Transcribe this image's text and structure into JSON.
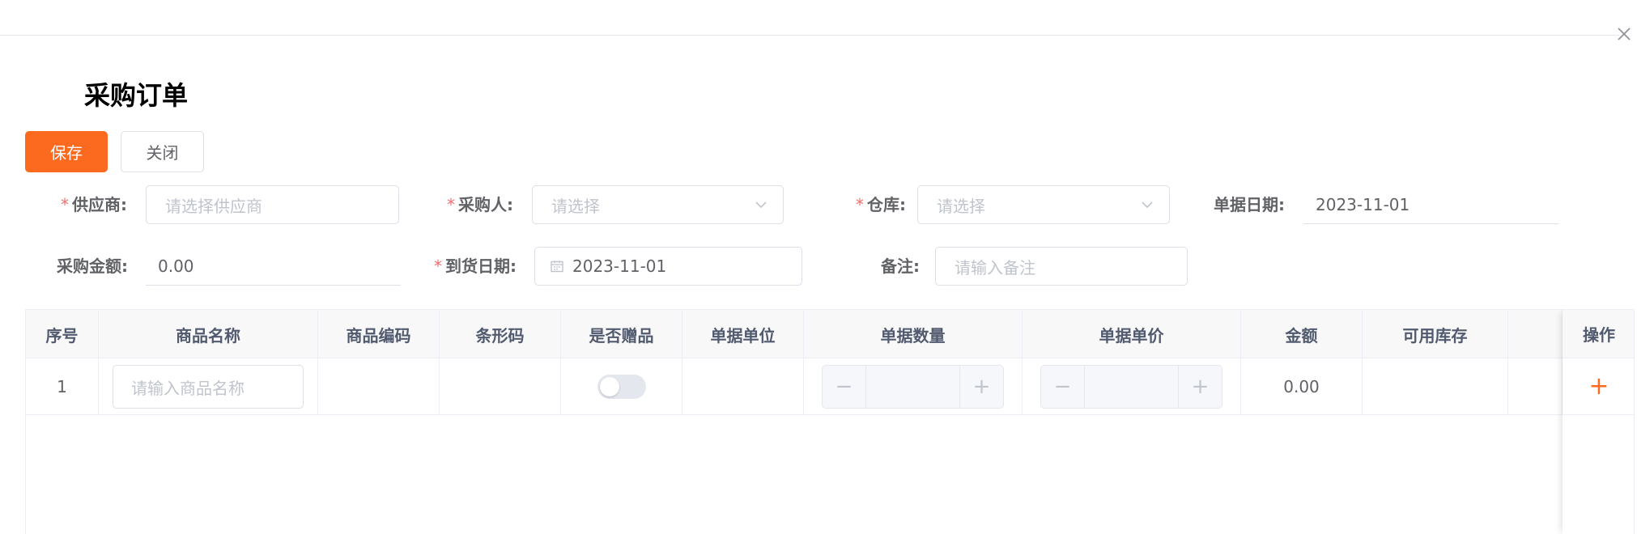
{
  "page": {
    "title": "采购订单"
  },
  "toolbar": {
    "save_label": "保存",
    "close_label": "关闭"
  },
  "form": {
    "supplier": {
      "label": "供应商:",
      "placeholder": "请选择供应商"
    },
    "purchaser": {
      "label": "采购人:",
      "placeholder": "请选择"
    },
    "warehouse": {
      "label": "仓库:",
      "placeholder": "请选择"
    },
    "doc_date": {
      "label": "单据日期:",
      "value": "2023-11-01"
    },
    "amount": {
      "label": "采购金额:",
      "value": "0.00"
    },
    "arrival_date": {
      "label": "到货日期:",
      "value": "2023-11-01"
    },
    "remark": {
      "label": "备注:",
      "placeholder": "请输入备注"
    }
  },
  "table": {
    "headers": [
      "序号",
      "商品名称",
      "商品编码",
      "条形码",
      "是否赠品",
      "单据单位",
      "单据数量",
      "单据单价",
      "金额",
      "可用库存",
      "操作"
    ],
    "rows": [
      {
        "index": "1",
        "product_placeholder": "请输入商品名称",
        "amount": "0.00",
        "gift": false
      }
    ]
  },
  "icons": {
    "close": "close-icon",
    "chevron": "chevron-down-icon",
    "calendar": "calendar-icon",
    "plus": "plus-icon"
  },
  "colors": {
    "accent": "#fb6a1e",
    "required": "#f56c6c"
  }
}
